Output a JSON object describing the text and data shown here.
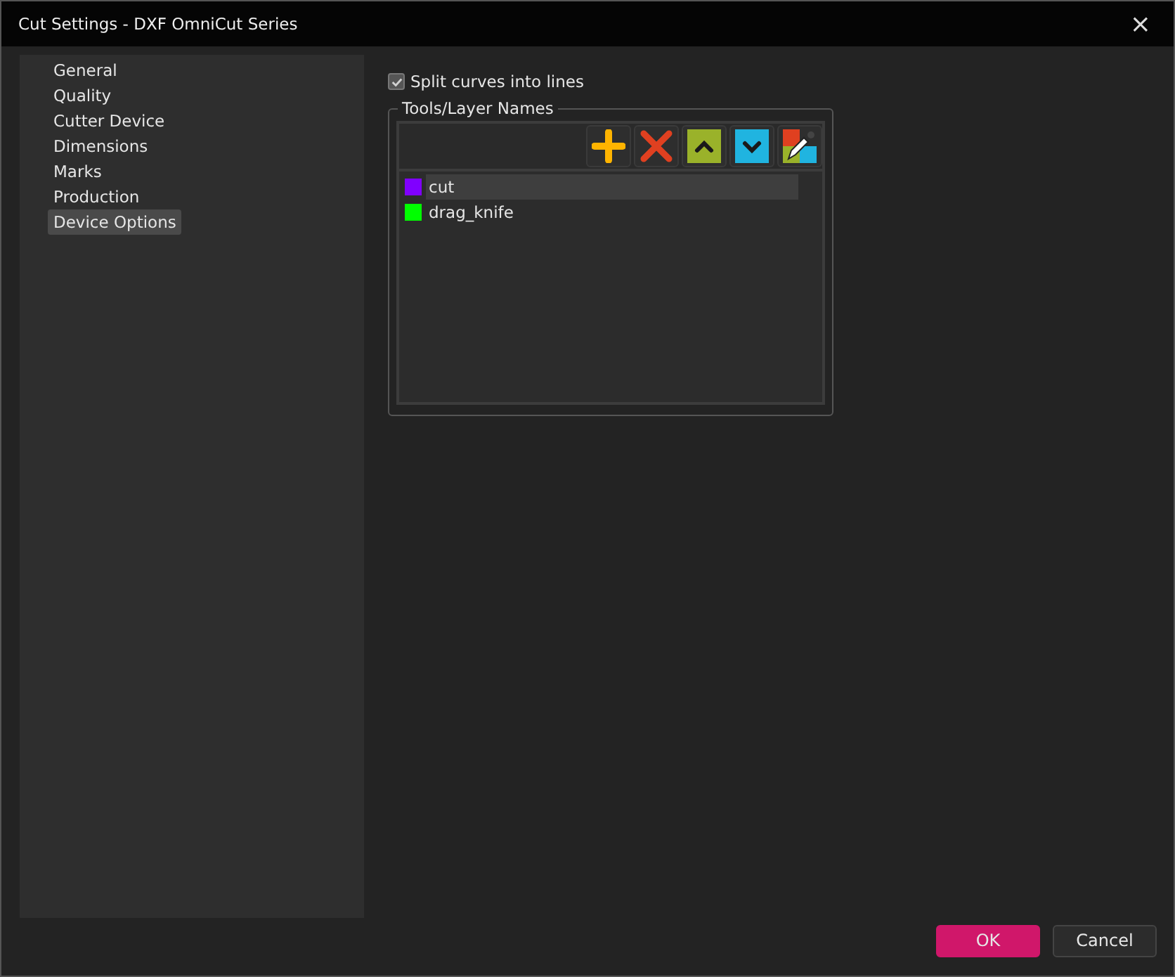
{
  "window": {
    "title": "Cut Settings - DXF OmniCut Series",
    "close": "×"
  },
  "sidebar": {
    "items": [
      {
        "label": "General",
        "selected": false
      },
      {
        "label": "Quality",
        "selected": false
      },
      {
        "label": "Cutter Device",
        "selected": false
      },
      {
        "label": "Dimensions",
        "selected": false
      },
      {
        "label": "Marks",
        "selected": false
      },
      {
        "label": "Production",
        "selected": false
      },
      {
        "label": "Device Options",
        "selected": true
      }
    ]
  },
  "split_curves": {
    "label": "Split curves into lines",
    "checked": true
  },
  "tools_group": {
    "title": "Tools/Layer Names",
    "layers": [
      {
        "name": "cut",
        "color": "#8000ff",
        "selected": true
      },
      {
        "name": "drag_knife",
        "color": "#00ff00",
        "selected": false
      }
    ]
  },
  "buttons": [
    {
      "label": "OK",
      "kind": "primary"
    },
    {
      "label": "Cancel",
      "kind": "secondary"
    }
  ]
}
